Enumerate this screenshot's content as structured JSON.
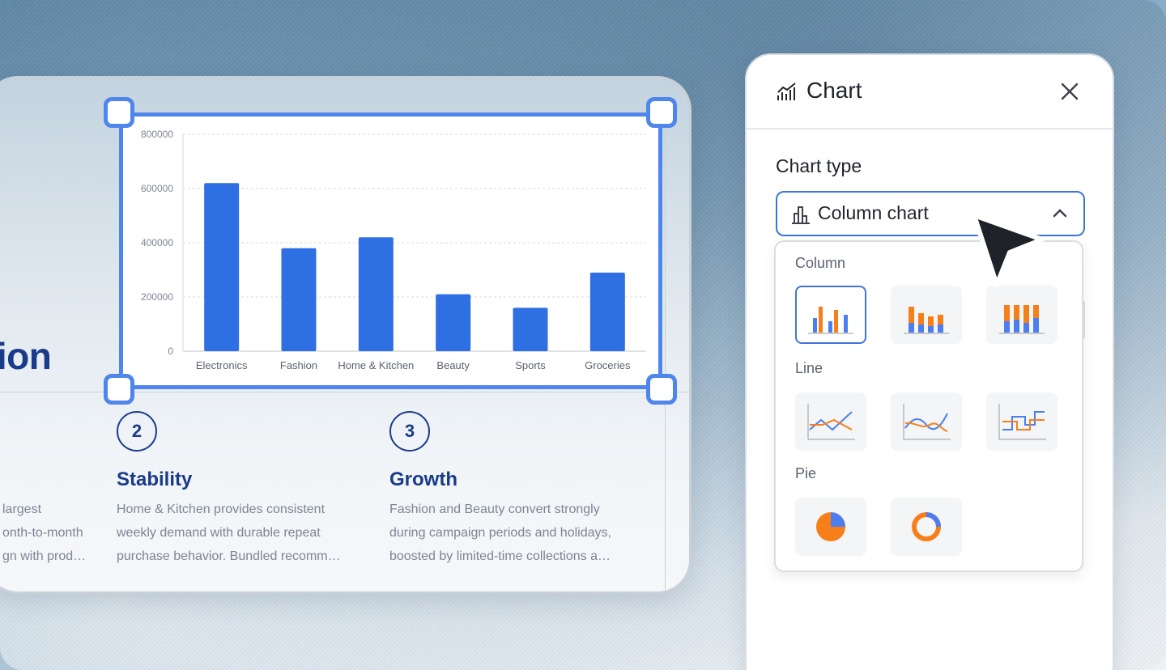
{
  "slide": {
    "title_fragment": "tion",
    "title_tick": "/",
    "columns": [
      {
        "number": "",
        "title": "",
        "lines": [
          "largest",
          "onth-to-month",
          "gn with prod…"
        ]
      },
      {
        "number": "2",
        "title": "Stability",
        "lines": [
          "Home & Kitchen provides consistent",
          "weekly demand with durable repeat",
          "purchase behavior. Bundled recomm…"
        ]
      },
      {
        "number": "3",
        "title": "Growth",
        "lines": [
          "Fashion and Beauty convert strongly",
          "during campaign periods and holidays,",
          "boosted by limited-time collections a…"
        ]
      }
    ]
  },
  "chart_data": {
    "type": "bar",
    "categories": [
      "Electronics",
      "Fashion",
      "Home & Kitchen",
      "Beauty",
      "Sports",
      "Groceries"
    ],
    "values": [
      620000,
      380000,
      420000,
      210000,
      160000,
      290000
    ],
    "ylim": [
      0,
      800000
    ],
    "yticks": [
      "0",
      "200000",
      "400000",
      "600000",
      "800000"
    ],
    "grid": true,
    "bar_color": "#2f6fe4",
    "title": "",
    "xlabel": "",
    "ylabel": ""
  },
  "panel": {
    "title": "Chart",
    "title_icon": "line-chart-icon",
    "close_icon": "close-icon",
    "chart_type_label": "Chart type",
    "selected_type": "Column chart",
    "selected_icon": "column-chart-icon",
    "groups": [
      {
        "label": "Column",
        "options": [
          "clustered-column",
          "stacked-column",
          "percent-stacked-column"
        ]
      },
      {
        "label": "Line",
        "options": [
          "line",
          "smooth-line",
          "step-line"
        ]
      },
      {
        "label": "Pie",
        "options": [
          "pie",
          "donut"
        ]
      }
    ]
  },
  "colors": {
    "accent": "#3f74e0",
    "bar_blue": "#4d7ef0",
    "bar_orange": "#f77f1a",
    "title_navy": "#1a3b8a"
  }
}
